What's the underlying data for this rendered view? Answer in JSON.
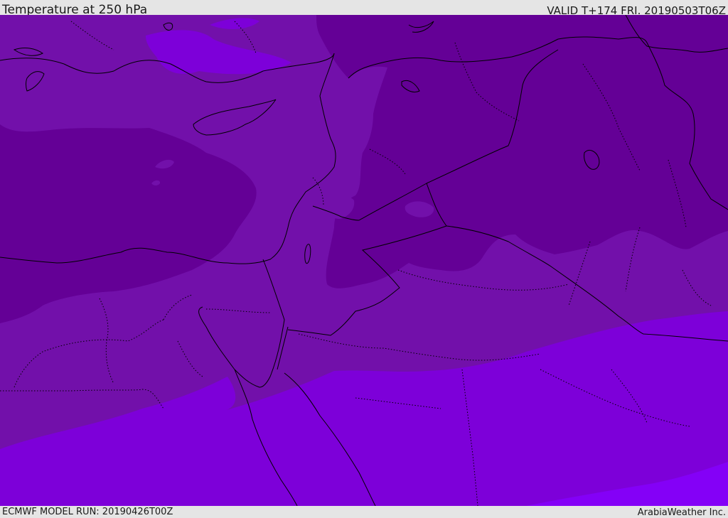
{
  "header": {
    "title": "Temperature at 250 hPa",
    "valid": "VALID T+174 FRI. 20190503T06Z"
  },
  "footer": {
    "model_run": "ECMWF MODEL RUN: 20190426T00Z",
    "credit": "ArabiaWeather Inc."
  },
  "map": {
    "colors": {
      "coldest": "#640096",
      "cold": "#7210aa",
      "mild": "#7d00d9",
      "warm": "#8400f7",
      "land_line": "#000000"
    }
  }
}
